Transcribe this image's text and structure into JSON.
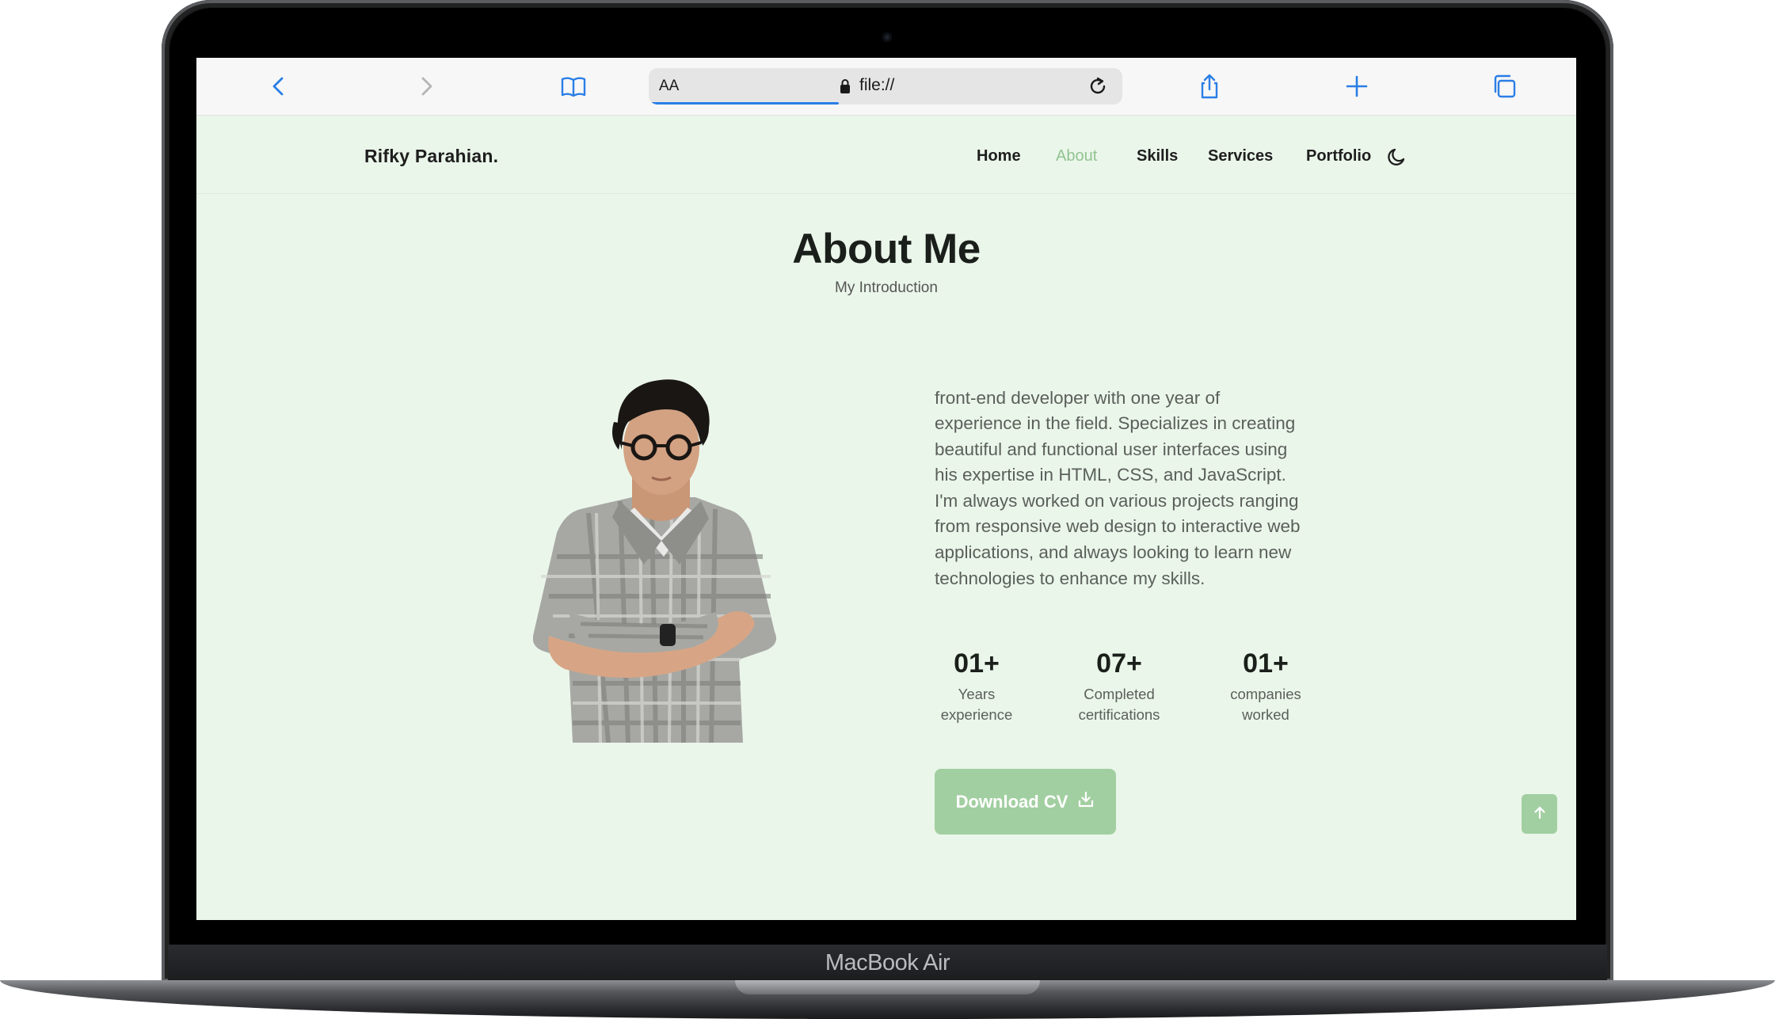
{
  "device": {
    "label": "MacBook Air"
  },
  "browser": {
    "text_size_label": "AA",
    "url": "file://",
    "icons": [
      "back-icon",
      "forward-icon",
      "bookmarks-icon",
      "lock-icon",
      "reload-icon",
      "share-icon",
      "new-tab-icon",
      "tabs-icon"
    ],
    "accent": "#2a7ee6"
  },
  "site": {
    "logo": "Rifky Parahian.",
    "nav": [
      {
        "label": "Home"
      },
      {
        "label": "About",
        "active": true
      },
      {
        "label": "Skills"
      },
      {
        "label": "Services"
      },
      {
        "label": "Portfolio"
      }
    ],
    "theme_toggle_icon": "moon-icon"
  },
  "about": {
    "title": "About Me",
    "subtitle": "My Introduction",
    "description": "front-end developer with one year of experience in the field. Specializes in creating beautiful and functional user interfaces using his expertise in HTML, CSS, and JavaScript. I'm always worked on various projects ranging from responsive web design to interactive web applications, and always looking to learn new technologies to enhance my skills.",
    "stats": [
      {
        "value": "01+",
        "line1": "Years",
        "line2": "experience"
      },
      {
        "value": "07+",
        "line1": "Completed",
        "line2": "certifications"
      },
      {
        "value": "01+",
        "line1": "companies",
        "line2": "worked"
      }
    ],
    "cv_button": "Download CV",
    "cv_icon": "download-icon",
    "scroll_top_icon": "arrow-up-icon"
  },
  "colors": {
    "page_bg": "#eaf6ea",
    "accent": "#a2cfa1",
    "active_nav": "#92c392",
    "heading": "#1b1f1b"
  }
}
